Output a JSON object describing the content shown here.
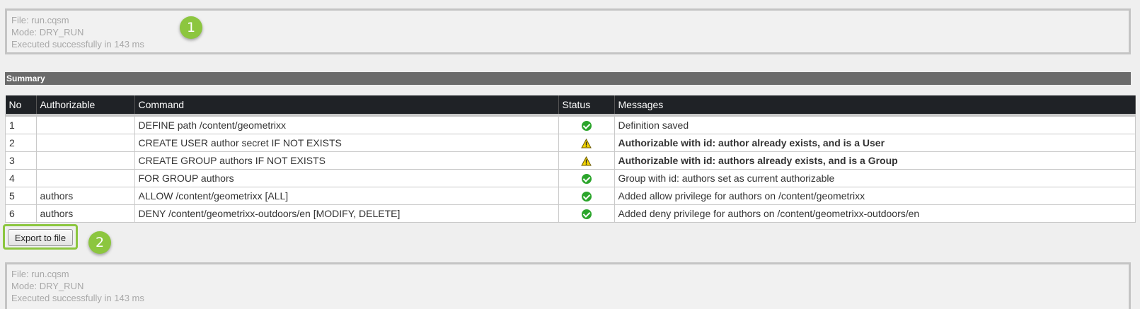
{
  "info_top": {
    "file": "File: run.cqsm",
    "mode": "Mode: DRY_RUN",
    "status": "Executed successfully in 143 ms"
  },
  "badges": {
    "one": "1",
    "two": "2"
  },
  "summary": {
    "title": "Summary"
  },
  "table": {
    "headers": [
      "No",
      "Authorizable",
      "Command",
      "Status",
      "Messages"
    ],
    "rows": [
      {
        "no": "1",
        "authorizable": "",
        "command": "DEFINE path /content/geometrixx",
        "status": "ok",
        "message": "Definition saved"
      },
      {
        "no": "2",
        "authorizable": "",
        "command": "CREATE USER author secret IF NOT EXISTS",
        "status": "warning",
        "message": "Authorizable with id: author already exists, and is a User"
      },
      {
        "no": "3",
        "authorizable": "",
        "command": "CREATE GROUP authors IF NOT EXISTS",
        "status": "warning",
        "message": "Authorizable with id: authors already exists, and is a Group"
      },
      {
        "no": "4",
        "authorizable": "",
        "command": "FOR GROUP authors",
        "status": "ok",
        "message": "Group with id: authors set as current authorizable"
      },
      {
        "no": "5",
        "authorizable": "authors",
        "command": "ALLOW /content/geometrixx [ALL]",
        "status": "ok",
        "message": "Added allow privilege for authors on /content/geometrixx"
      },
      {
        "no": "6",
        "authorizable": "authors",
        "command": "DENY /content/geometrixx-outdoors/en [MODIFY, DELETE]",
        "status": "ok",
        "message": "Added deny privilege for authors on /content/geometrixx-outdoors/en"
      }
    ]
  },
  "export_button": {
    "label": "Export to file"
  },
  "info_bottom": {
    "file": "File: run.cqsm",
    "mode": "Mode: DRY_RUN",
    "status": "Executed successfully in 143 ms"
  },
  "colors": {
    "badge": "#8cc63f",
    "header_bg": "#1f2226",
    "summary_bg": "#6b6b6b",
    "warning_text": "#c9a310",
    "ok_icon": "#2ba52b"
  },
  "icons": {
    "ok": "check-circle-icon",
    "warning": "warning-triangle-icon"
  }
}
